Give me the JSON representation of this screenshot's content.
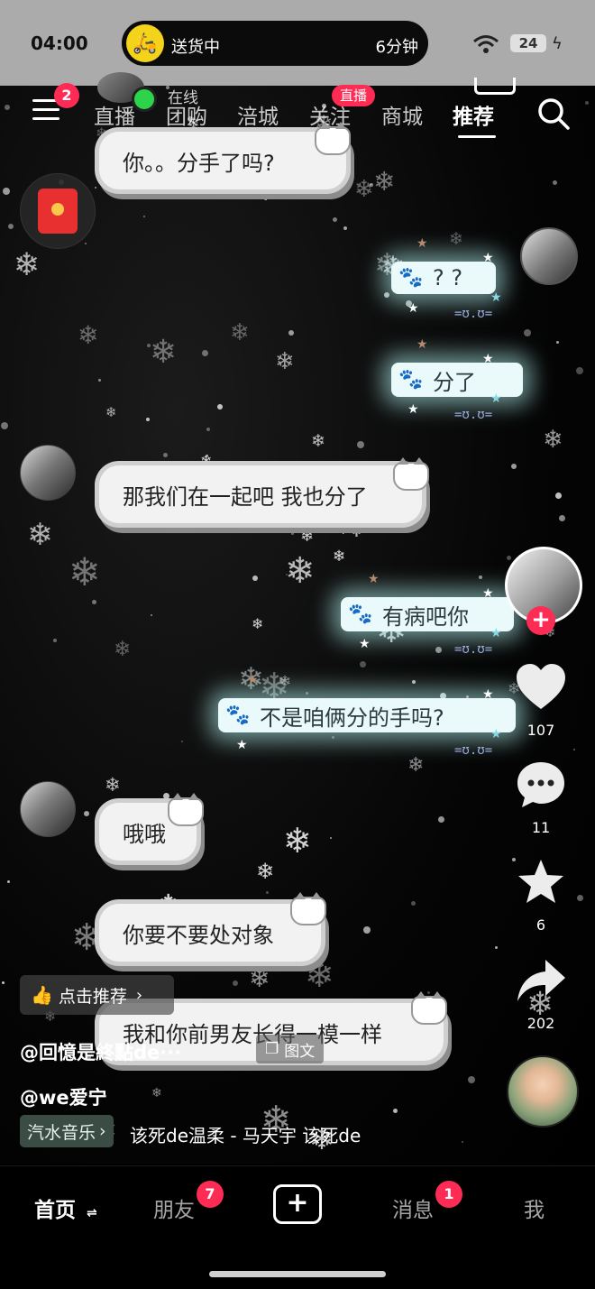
{
  "status_bar": {
    "time": "04:00",
    "delivery_text": "送货中",
    "delivery_eta": "6分钟",
    "battery": "24"
  },
  "top_nav": {
    "menu_badge": "2",
    "online_text": "在线",
    "live_badge": "直播",
    "tabs": [
      {
        "label": "直播"
      },
      {
        "label": "团购"
      },
      {
        "label": "涪城"
      },
      {
        "label": "关注"
      },
      {
        "label": "商城"
      },
      {
        "label": "推荐"
      }
    ]
  },
  "chat": {
    "messages": [
      {
        "side": "left",
        "text": "你。。分手了吗?"
      },
      {
        "side": "right",
        "text": "? ?"
      },
      {
        "side": "right",
        "text": "分了"
      },
      {
        "side": "left",
        "text": "那我们在一起吧 我也分了"
      },
      {
        "side": "right",
        "text": "有病吧你"
      },
      {
        "side": "right",
        "text": "不是咱俩分的手吗?"
      },
      {
        "side": "left",
        "text": "哦哦"
      },
      {
        "side": "left",
        "text": "你要不要处对象"
      },
      {
        "side": "left",
        "text": "我和你前男友长得一模一样"
      }
    ],
    "face_glyph": "=ʊ.ʊ="
  },
  "actions": {
    "likes": "107",
    "comments": "11",
    "favorites": "6",
    "shares": "202"
  },
  "info": {
    "recommend_label": "点击推荐",
    "author": "@回憶是終點de···",
    "image_text_label": "图文",
    "handle": "@we爱宁",
    "music_tag": "汽水音乐",
    "music_line": "该死de温柔 - 马天宇   该死de"
  },
  "bottom_nav": {
    "home": "首页",
    "friends": "朋友",
    "friends_badge": "7",
    "messages": "消息",
    "messages_badge": "1",
    "me": "我"
  },
  "colors": {
    "accent": "#fe2c55",
    "status_bar_bg": "#ababab",
    "right_bubble": "#eafafa",
    "left_bubble": "#f2f2f2",
    "music_tag_bg": "#3a4c44"
  }
}
